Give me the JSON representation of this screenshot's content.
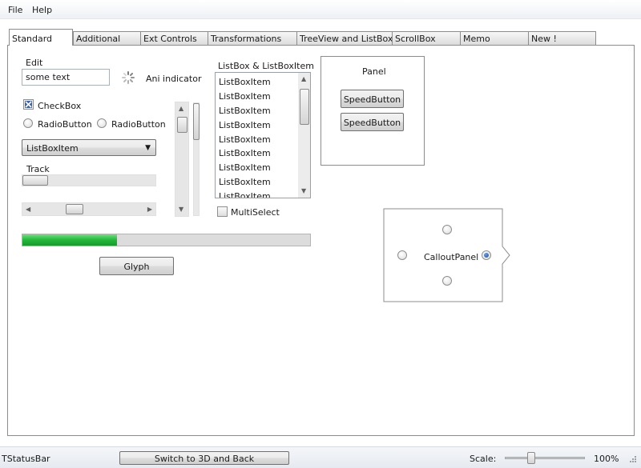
{
  "menu": {
    "items": [
      "File",
      "Help"
    ]
  },
  "tabs": [
    "Standard",
    "Additional",
    "Ext Controls",
    "Transformations",
    "TreeView and ListBox",
    "ScrollBox",
    "Memo",
    "New !"
  ],
  "standard": {
    "edit_label": "Edit",
    "edit_value": "some text",
    "ani_indicator_label": "Ani indicator",
    "checkbox_label": "CheckBox",
    "checkbox_checked": true,
    "radio1_label": "RadioButton",
    "radio2_label": "RadioButton",
    "combo_value": "ListBoxItem",
    "track_label": "Track",
    "track_value": 0.0,
    "hscroll_position": 0.45,
    "vscroll_position": 0.12,
    "progress_fraction": 0.33,
    "glyph_button": "Glyph",
    "listbox_label": "ListBox & ListBoxItem",
    "listbox_items": [
      "ListBoxItem",
      "ListBoxItem",
      "ListBoxItem",
      "ListBoxItem",
      "ListBoxItem",
      "ListBoxItem",
      "ListBoxItem",
      "ListBoxItem",
      "ListBoxItem"
    ],
    "multiselect_label": "MultiSelect",
    "multiselect_checked": false,
    "panel_label": "Panel",
    "speedbutton1": "SpeedButton",
    "speedbutton2": "SpeedButton",
    "callout_label": "CalloutPanel"
  },
  "status": {
    "text": "TStatusBar",
    "button": "Switch to 3D and Back",
    "scale_label": "Scale:",
    "scale_value": "100%",
    "scale_slider_fraction": 0.28
  },
  "colors": {
    "progress": "#22b83a",
    "accent": "#1a4fa0"
  }
}
